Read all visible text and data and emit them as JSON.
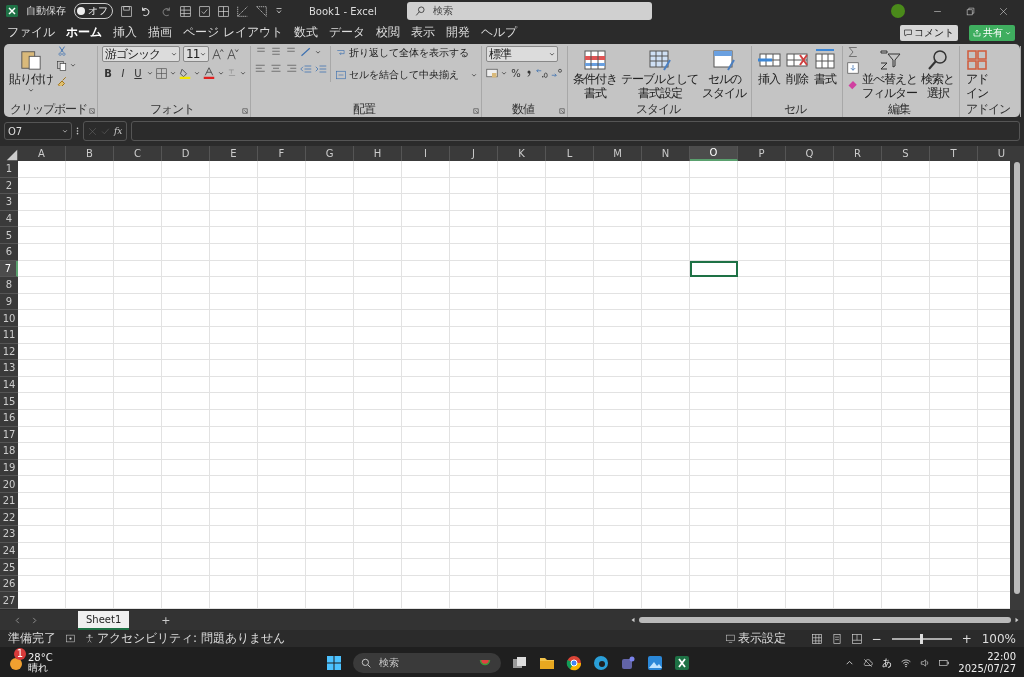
{
  "title_bar": {
    "autosave_label": "自動保存",
    "autosave": {
      "label": "オフ",
      "on": false
    },
    "title": "Book1  -  Excel",
    "search_placeholder": "検索"
  },
  "menu_tabs": [
    {
      "label": "ファイル",
      "selected": false
    },
    {
      "label": "ホーム",
      "selected": true
    },
    {
      "label": "挿入",
      "selected": false
    },
    {
      "label": "描画",
      "selected": false
    },
    {
      "label": "ページ レイアウト",
      "selected": false
    },
    {
      "label": "数式",
      "selected": false
    },
    {
      "label": "データ",
      "selected": false
    },
    {
      "label": "校閲",
      "selected": false
    },
    {
      "label": "表示",
      "selected": false
    },
    {
      "label": "開発",
      "selected": false
    },
    {
      "label": "ヘルプ",
      "selected": false
    }
  ],
  "comment_button": "コメント",
  "share_button": "共有",
  "ribbon": {
    "groups": [
      {
        "kind": "clipboard",
        "label": "クリップボード",
        "paste_label": "貼り付け"
      },
      {
        "kind": "font",
        "label": "フォント",
        "font_name": "游ゴシック",
        "font_size": "11",
        "bold": "B",
        "italic": "I",
        "underline": "U"
      },
      {
        "kind": "alignment",
        "label": "配置",
        "wrap_label": "折り返して全体を表示する",
        "merge_label": "セルを結合して中央揃え"
      },
      {
        "kind": "number",
        "label": "数値",
        "format": "標準",
        "percent": "%"
      },
      {
        "kind": "styles",
        "label": "スタイル",
        "buttons": [
          {
            "lines": [
              "条件付き",
              "書式"
            ]
          },
          {
            "lines": [
              "テーブルとして",
              "書式設定"
            ]
          },
          {
            "lines": [
              "セルの",
              "スタイル"
            ]
          }
        ]
      },
      {
        "kind": "cells",
        "label": "セル",
        "buttons": [
          {
            "lines": [
              "挿入"
            ]
          },
          {
            "lines": [
              "削除"
            ]
          },
          {
            "lines": [
              "書式"
            ]
          }
        ]
      },
      {
        "kind": "editing",
        "label": "編集",
        "buttons": [
          {
            "lines": [
              "並べ替えと",
              "フィルター"
            ]
          },
          {
            "lines": [
              "検索と",
              "選択"
            ]
          }
        ]
      },
      {
        "kind": "addins",
        "label": "アドイン",
        "buttons": [
          {
            "lines": [
              "アド",
              "イン"
            ]
          }
        ]
      }
    ]
  },
  "formula_bar": {
    "name_box": "O7",
    "fx": "fx"
  },
  "grid": {
    "columns": [
      {
        "label": "A",
        "selected": false
      },
      {
        "label": "B",
        "selected": false
      },
      {
        "label": "C",
        "selected": false
      },
      {
        "label": "D",
        "selected": false
      },
      {
        "label": "E",
        "selected": false
      },
      {
        "label": "F",
        "selected": false
      },
      {
        "label": "G",
        "selected": false
      },
      {
        "label": "H",
        "selected": false
      },
      {
        "label": "I",
        "selected": false
      },
      {
        "label": "J",
        "selected": false
      },
      {
        "label": "K",
        "selected": false
      },
      {
        "label": "L",
        "selected": false
      },
      {
        "label": "M",
        "selected": false
      },
      {
        "label": "N",
        "selected": false
      },
      {
        "label": "O",
        "selected": true
      },
      {
        "label": "P",
        "selected": false
      },
      {
        "label": "Q",
        "selected": false
      },
      {
        "label": "R",
        "selected": false
      },
      {
        "label": "S",
        "selected": false
      },
      {
        "label": "T",
        "selected": false
      },
      {
        "label": "U",
        "selected": false
      }
    ],
    "rows": [
      {
        "label": "1",
        "selected": false
      },
      {
        "label": "2",
        "selected": false
      },
      {
        "label": "3",
        "selected": false
      },
      {
        "label": "4",
        "selected": false
      },
      {
        "label": "5",
        "selected": false
      },
      {
        "label": "6",
        "selected": false
      },
      {
        "label": "7",
        "selected": true
      },
      {
        "label": "8",
        "selected": false
      },
      {
        "label": "9",
        "selected": false
      },
      {
        "label": "10",
        "selected": false
      },
      {
        "label": "11",
        "selected": false
      },
      {
        "label": "12",
        "selected": false
      },
      {
        "label": "13",
        "selected": false
      },
      {
        "label": "14",
        "selected": false
      },
      {
        "label": "15",
        "selected": false
      },
      {
        "label": "16",
        "selected": false
      },
      {
        "label": "17",
        "selected": false
      },
      {
        "label": "18",
        "selected": false
      },
      {
        "label": "19",
        "selected": false
      },
      {
        "label": "20",
        "selected": false
      },
      {
        "label": "21",
        "selected": false
      },
      {
        "label": "22",
        "selected": false
      },
      {
        "label": "23",
        "selected": false
      },
      {
        "label": "24",
        "selected": false
      },
      {
        "label": "25",
        "selected": false
      },
      {
        "label": "26",
        "selected": false
      },
      {
        "label": "27",
        "selected": false
      }
    ]
  },
  "sheet_tabs": [
    {
      "label": "Sheet1",
      "selected": true
    }
  ],
  "add_sheet": "+",
  "status_bar": {
    "ready": "準備完了",
    "accessibility": "アクセシビリティ: 問題ありません",
    "display_settings": "表示設定",
    "zoom_minus": "−",
    "zoom_plus": "+",
    "zoom": {
      "level": 0.5
    },
    "zoom_percent": "100%"
  },
  "taskbar": {
    "weather": {
      "temperature": "28°C",
      "condition": "晴れ",
      "badge": "1"
    },
    "search_placeholder": "検索",
    "ime": "あ",
    "time": "22:00",
    "date": "2025/07/27"
  }
}
